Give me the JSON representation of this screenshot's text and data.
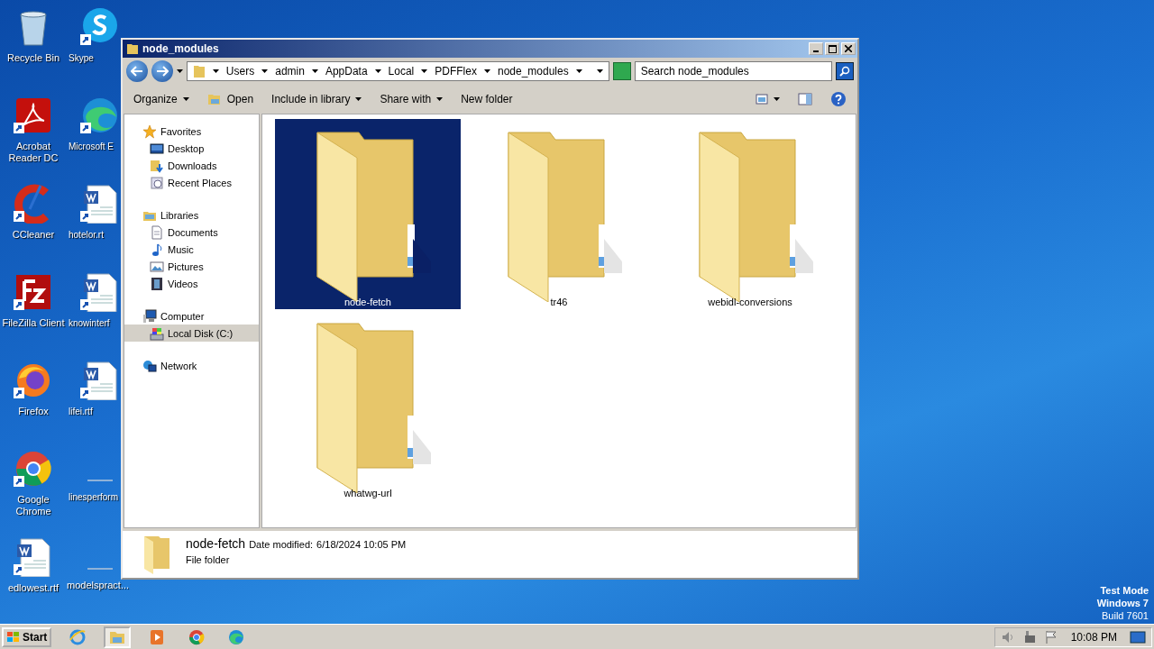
{
  "desktop": {
    "columns": [
      [
        {
          "label": "Recycle Bin",
          "kind": "recycle"
        },
        {
          "label": "Acrobat Reader DC",
          "kind": "pdf"
        },
        {
          "label": "CCleaner",
          "kind": "ccleaner"
        },
        {
          "label": "FileZilla Client",
          "kind": "filezilla"
        },
        {
          "label": "Firefox",
          "kind": "firefox"
        },
        {
          "label": "Google Chrome",
          "kind": "chrome"
        },
        {
          "label": "edlowest.rtf",
          "kind": "doc"
        }
      ],
      [
        {
          "label": "Skype",
          "kind": "skype"
        },
        {
          "label": "Microsoft E",
          "kind": "edge"
        },
        {
          "label": "hotelor.rt",
          "kind": "doc"
        },
        {
          "label": "knowinterf",
          "kind": "doc"
        },
        {
          "label": "lifei.rtf",
          "kind": "doc"
        },
        {
          "label": "linesperform",
          "kind": "blank"
        },
        {
          "label": "modelspract...",
          "kind": "blank"
        }
      ]
    ],
    "watermark": [
      "Test Mode",
      "Windows 7",
      "Build 7601"
    ]
  },
  "window": {
    "title": "node_modules",
    "breadcrumbs": [
      "Users",
      "admin",
      "AppData",
      "Local",
      "PDFFlex",
      "node_modules"
    ],
    "search": {
      "placeholder": "Search node_modules"
    },
    "toolbar": [
      {
        "label": "Organize",
        "kind": "menu"
      },
      {
        "label": "Open",
        "kind": "open"
      },
      {
        "label": "Include in library",
        "kind": "menu"
      },
      {
        "label": "Share with",
        "kind": "menu"
      },
      {
        "label": "New folder",
        "kind": "plain"
      }
    ],
    "nav": [
      {
        "label": "Favorites",
        "kind": "star",
        "selected": false,
        "children": [
          {
            "label": "Desktop",
            "kind": "desktop",
            "selected": false
          },
          {
            "label": "Downloads",
            "kind": "downloads",
            "selected": false
          },
          {
            "label": "Recent Places",
            "kind": "recent",
            "selected": false
          }
        ]
      },
      {
        "label": "Libraries",
        "kind": "libraries",
        "selected": false,
        "children": [
          {
            "label": "Documents",
            "kind": "documents",
            "selected": false
          },
          {
            "label": "Music",
            "kind": "music",
            "selected": false
          },
          {
            "label": "Pictures",
            "kind": "pictures",
            "selected": false
          },
          {
            "label": "Videos",
            "kind": "videos",
            "selected": false
          }
        ]
      },
      {
        "label": "Computer",
        "kind": "computer",
        "selected": false,
        "children": [
          {
            "label": "Local Disk (C:)",
            "kind": "disk",
            "selected": true
          }
        ]
      },
      {
        "label": "Network",
        "kind": "network",
        "selected": false
      }
    ],
    "items": [
      {
        "name": "node-fetch",
        "selected": true
      },
      {
        "name": "tr46",
        "selected": false
      },
      {
        "name": "webidl-conversions",
        "selected": false
      },
      {
        "name": "whatwg-url",
        "selected": false
      }
    ],
    "details": {
      "name": "node-fetch",
      "date_label": "Date modified:",
      "date": "6/18/2024 10:05 PM",
      "type": "File folder"
    }
  },
  "taskbar": {
    "start": "Start",
    "apps": [
      {
        "kind": "ie",
        "active": false
      },
      {
        "kind": "explorer",
        "active": true
      },
      {
        "kind": "media",
        "active": false
      },
      {
        "kind": "chrome",
        "active": false
      },
      {
        "kind": "edge",
        "active": false
      }
    ],
    "time": "10:08 PM"
  }
}
